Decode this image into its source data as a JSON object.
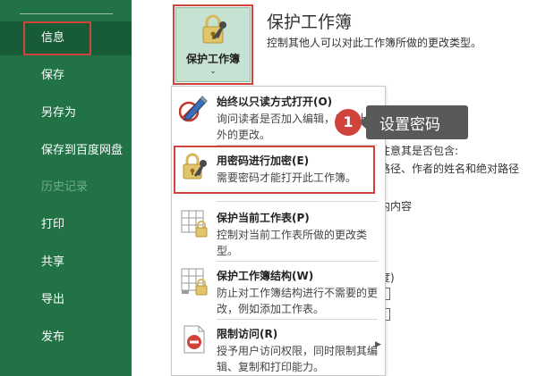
{
  "sidebar": {
    "items": [
      {
        "label": "信息",
        "active": true
      },
      {
        "label": "保存"
      },
      {
        "label": "另存为"
      },
      {
        "label": "保存到百度网盘"
      },
      {
        "label": "历史记录",
        "disabled": true
      },
      {
        "label": "打印"
      },
      {
        "label": "共享"
      },
      {
        "label": "导出"
      },
      {
        "label": "发布"
      }
    ]
  },
  "protect": {
    "tile_label": "保护工作簿",
    "caret": "⌄",
    "title": "保护工作簿",
    "description": "控制其他人可以对此工作簿所做的更改类型。"
  },
  "background": {
    "line1": "注意其是否包含:",
    "line2": "路径、作者的姓名和绝对路径",
    "line3": "内内容",
    "box_char": "度)"
  },
  "menu": {
    "items": [
      {
        "title": "始终以只读方式打开(O)",
        "desc": "询问读者是否加入编辑，以防止意外的更改。",
        "icon": "pencil-read-only-icon"
      },
      {
        "title": "用密码进行加密(E)",
        "desc": "需要密码才能打开此工作簿。",
        "icon": "lock-key-icon"
      },
      {
        "title": "保护当前工作表(P)",
        "desc": "控制对当前工作表所做的更改类型。",
        "icon": "sheet-lock-icon"
      },
      {
        "title": "保护工作簿结构(W)",
        "desc": "防止对工作簿结构进行不需要的更改，例如添加工作表。",
        "icon": "workbook-structure-lock-icon"
      },
      {
        "title": "限制访问(R)",
        "desc": "授予用户访问权限，同时限制其编辑、复制和打印能力。",
        "icon": "restrict-access-icon"
      }
    ]
  },
  "callout": {
    "number": "1",
    "text": "设置密码"
  },
  "colors": {
    "sidebar_bg": "#217346",
    "sidebar_active": "#185c37",
    "highlight_red": "#d0433c",
    "tile_bg": "#c6e2d2",
    "callout_bg": "#595959"
  }
}
